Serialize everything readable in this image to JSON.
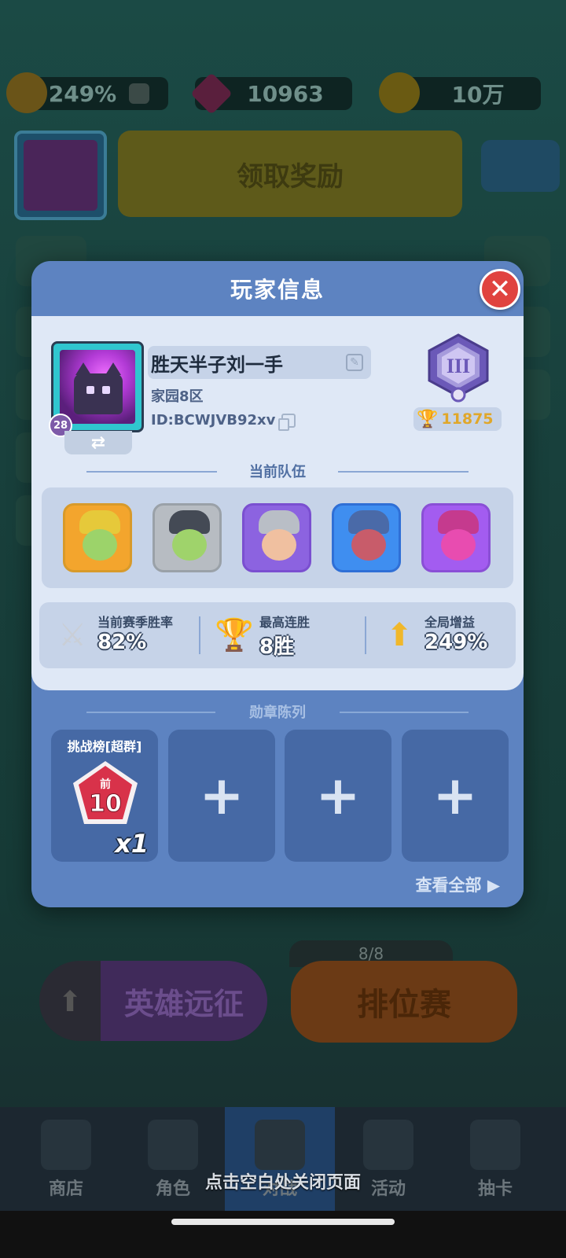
{
  "background": {
    "boost_percent": "249%",
    "gems": "10963",
    "coins": "10万",
    "claim_button": "领取奖励",
    "avatar_level": "28",
    "expedition_button": "英雄远征",
    "ranked_button": "排位赛",
    "ranked_progress": "8/8",
    "nav": [
      {
        "label": "商店"
      },
      {
        "label": "角色"
      },
      {
        "label": "对战"
      },
      {
        "label": "活动"
      },
      {
        "label": "抽卡"
      }
    ],
    "dismiss_hint": "点击空白处关闭页面"
  },
  "modal": {
    "title": "玩家信息",
    "close_icon": "close-icon",
    "player": {
      "name": "胜天半子刘一手",
      "server": "家园8区",
      "id": "ID:BCWJVB92xv",
      "level": "28",
      "rank_numeral": "III",
      "trophies": "11875"
    },
    "team_label": "当前队伍",
    "team": [
      {
        "name": "hero-1",
        "border": "#d89a2a",
        "bg": "#f3a52d",
        "face": "#9cd36a",
        "hat": "#e6c93a"
      },
      {
        "name": "hero-2",
        "border": "#9aa1a8",
        "bg": "#b7bcc2",
        "face": "#9fd36b",
        "hat": "#444a55"
      },
      {
        "name": "hero-3",
        "border": "#7a4fd0",
        "bg": "#8c63e0",
        "face": "#f0c0a0",
        "hat": "#b9bec6"
      },
      {
        "name": "hero-4",
        "border": "#2f6fd6",
        "bg": "#3f8ef0",
        "face": "#c85c6a",
        "hat": "#4a6aa8"
      },
      {
        "name": "hero-5",
        "border": "#8a4fd6",
        "bg": "#a35cf0",
        "face": "#e84cb0",
        "hat": "#c53a8e"
      }
    ],
    "stats": [
      {
        "label": "当前赛季胜率",
        "value": "82%",
        "icon": "swords-icon"
      },
      {
        "label": "最高连胜",
        "value": "8胜",
        "icon": "trophy-icon"
      },
      {
        "label": "全局增益",
        "value": "249%",
        "icon": "boost-icon"
      }
    ],
    "badges_label": "勋章陈列",
    "badges": [
      {
        "title": "挑战榜[超群]",
        "rank_top": "前",
        "rank_num": "10",
        "count": "x1"
      }
    ],
    "empty_slot_symbol": "+",
    "view_all": "查看全部 ▶"
  }
}
